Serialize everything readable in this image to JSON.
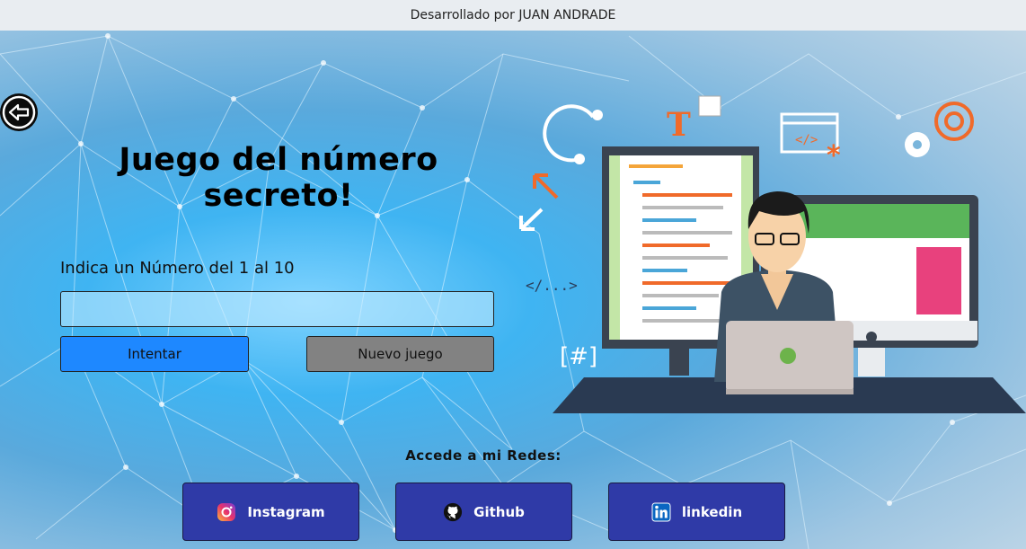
{
  "topbar": {
    "credit": "Desarrollado por JUAN ANDRADE"
  },
  "nav": {
    "back_icon": "arrow-left-circle-icon"
  },
  "game": {
    "title_line1": "Juego del número",
    "title_line2": "secreto!",
    "prompt": "Indica un Número del 1 al 10",
    "input_value": "",
    "try_label": "Intentar",
    "new_game_label": "Nuevo juego"
  },
  "illustration": {
    "code_tag": "</...>",
    "hash_tag": "[#]",
    "html_tag": "</>",
    "letter": "T"
  },
  "social": {
    "title": "Accede a mi Redes:",
    "items": [
      {
        "label": "Instagram",
        "icon": "instagram-icon"
      },
      {
        "label": "Github",
        "icon": "github-icon"
      },
      {
        "label": "linkedin",
        "icon": "linkedin-icon"
      }
    ]
  },
  "colors": {
    "try_button": "#1e88ff",
    "new_game_button": "#828282",
    "social_button": "#2f3aa7",
    "topbar": "#e9edf1"
  }
}
